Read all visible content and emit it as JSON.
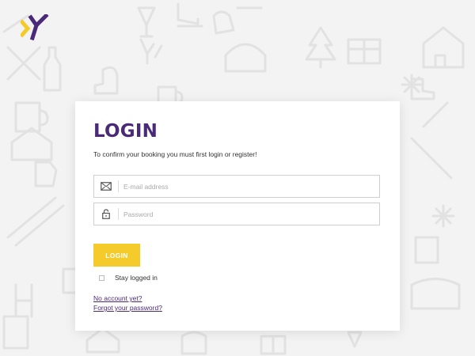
{
  "login": {
    "title": "LOGIN",
    "subtitle": "To confirm your booking you must first login or register!",
    "email": {
      "value": "",
      "placeholder": "E-mail address",
      "icon": "envelope-icon"
    },
    "password": {
      "value": "",
      "placeholder": "Password",
      "icon": "padlock-icon"
    },
    "submit_label": "LOGIN",
    "stay_logged_in": {
      "label": "Stay logged in",
      "checked": false
    },
    "links": {
      "no_account": "No account yet?",
      "forgot_password": "Forgot your password?"
    }
  },
  "colors": {
    "brand_purple": "#4a2a78",
    "accent_yellow": "#f5cb2b",
    "background": "#f3f3f3"
  },
  "logo": {
    "icon": "brand-logo-icon"
  }
}
